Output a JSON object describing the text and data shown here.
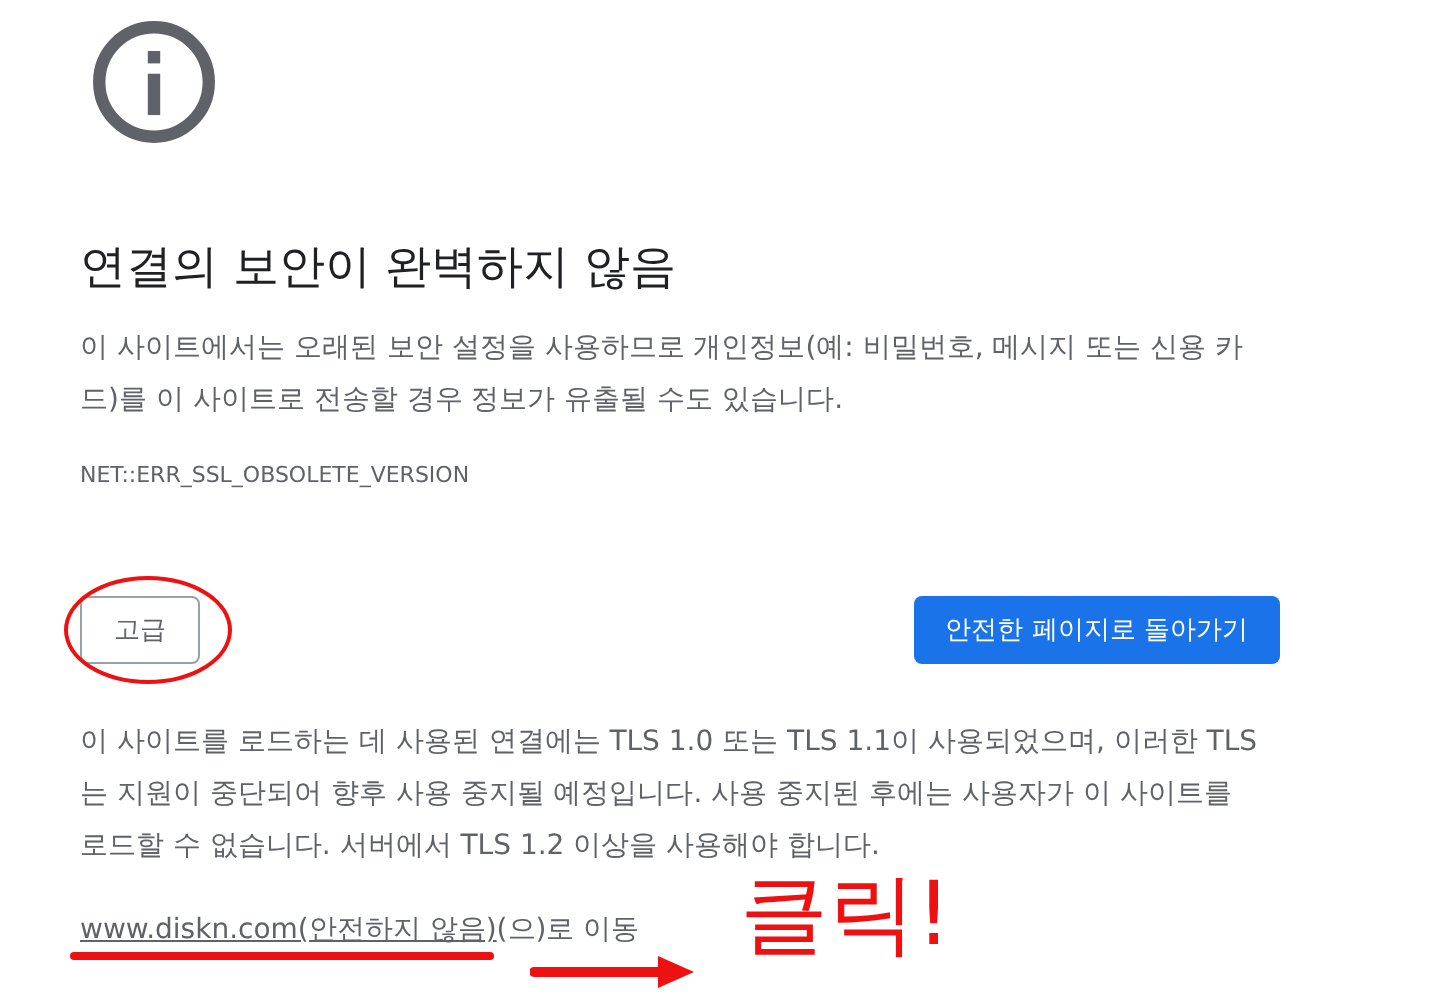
{
  "title": "연결의 보안이 완벽하지 않음",
  "description": "이 사이트에서는 오래된 보안 설정을 사용하므로 개인정보(예: 비밀번호, 메시지 또는 신용 카드)를 이 사이트로 전송할 경우 정보가 유출될 수도 있습니다.",
  "error_code": "NET::ERR_SSL_OBSOLETE_VERSION",
  "buttons": [
    {
      "label": "고급",
      "kind": "secondary"
    },
    {
      "label": "안전한 페이지로 돌아가기",
      "kind": "primary"
    }
  ],
  "details": "이 사이트를 로드하는 데 사용된 연결에는 TLS 1.0 또는 TLS 1.1이 사용되었으며, 이러한 TLS는 지원이 중단되어 향후 사용 중지될 예정입니다. 사용 중지된 후에는 사용자가 이 사이트를 로드할 수 없습니다. 서버에서 TLS 1.2 이상을 사용해야 합니다.",
  "proceed": {
    "link": "www.diskn.com(안전하지 않음)",
    "suffix": "(으)로 이동"
  },
  "annotation": {
    "text": "클릭!"
  }
}
